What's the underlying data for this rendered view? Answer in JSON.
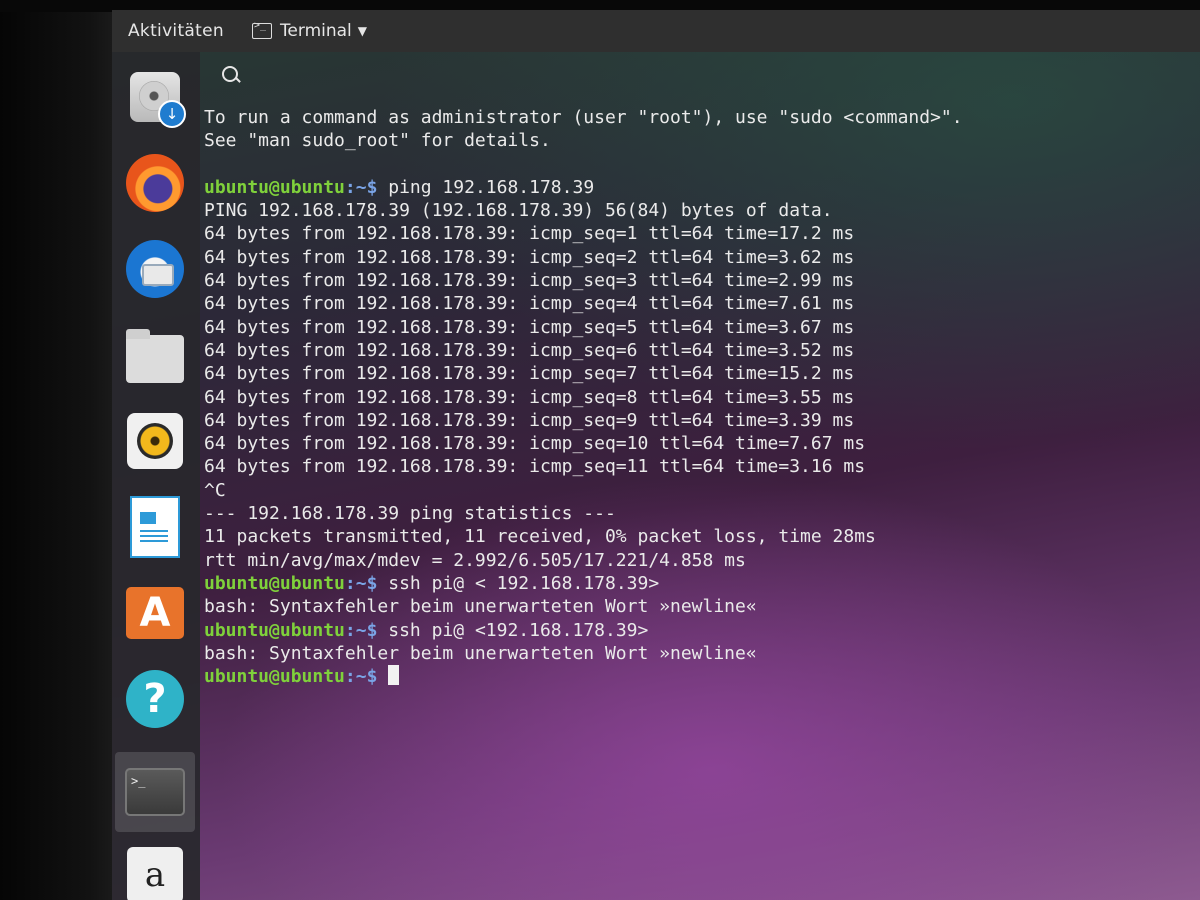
{
  "topbar": {
    "activities": "Aktivitäten",
    "app_name": "Terminal"
  },
  "dock": {
    "items": [
      {
        "icon": "disk-installer-icon"
      },
      {
        "icon": "firefox-icon"
      },
      {
        "icon": "thunderbird-icon"
      },
      {
        "icon": "files-icon"
      },
      {
        "icon": "rhythmbox-icon"
      },
      {
        "icon": "libreoffice-writer-icon"
      },
      {
        "icon": "software-store-icon",
        "glyph": "A"
      },
      {
        "icon": "help-icon",
        "glyph": "?"
      },
      {
        "icon": "terminal-icon",
        "glyph": ">_"
      },
      {
        "icon": "amazon-icon",
        "glyph": "a"
      }
    ]
  },
  "terminal": {
    "prompt_user": "ubuntu@ubuntu",
    "prompt_sep": ":~$ ",
    "lines": [
      {
        "type": "text",
        "text": "To run a command as administrator (user \"root\"), use \"sudo <command>\"."
      },
      {
        "type": "text",
        "text": "See \"man sudo_root\" for details."
      },
      {
        "type": "text",
        "text": ""
      },
      {
        "type": "prompt",
        "cmd": "ping 192.168.178.39"
      },
      {
        "type": "text",
        "text": "PING 192.168.178.39 (192.168.178.39) 56(84) bytes of data."
      },
      {
        "type": "text",
        "text": "64 bytes from 192.168.178.39: icmp_seq=1 ttl=64 time=17.2 ms"
      },
      {
        "type": "text",
        "text": "64 bytes from 192.168.178.39: icmp_seq=2 ttl=64 time=3.62 ms"
      },
      {
        "type": "text",
        "text": "64 bytes from 192.168.178.39: icmp_seq=3 ttl=64 time=2.99 ms"
      },
      {
        "type": "text",
        "text": "64 bytes from 192.168.178.39: icmp_seq=4 ttl=64 time=7.61 ms"
      },
      {
        "type": "text",
        "text": "64 bytes from 192.168.178.39: icmp_seq=5 ttl=64 time=3.67 ms"
      },
      {
        "type": "text",
        "text": "64 bytes from 192.168.178.39: icmp_seq=6 ttl=64 time=3.52 ms"
      },
      {
        "type": "text",
        "text": "64 bytes from 192.168.178.39: icmp_seq=7 ttl=64 time=15.2 ms"
      },
      {
        "type": "text",
        "text": "64 bytes from 192.168.178.39: icmp_seq=8 ttl=64 time=3.55 ms"
      },
      {
        "type": "text",
        "text": "64 bytes from 192.168.178.39: icmp_seq=9 ttl=64 time=3.39 ms"
      },
      {
        "type": "text",
        "text": "64 bytes from 192.168.178.39: icmp_seq=10 ttl=64 time=7.67 ms"
      },
      {
        "type": "text",
        "text": "64 bytes from 192.168.178.39: icmp_seq=11 ttl=64 time=3.16 ms"
      },
      {
        "type": "text",
        "text": "^C"
      },
      {
        "type": "text",
        "text": "--- 192.168.178.39 ping statistics ---"
      },
      {
        "type": "text",
        "text": "11 packets transmitted, 11 received, 0% packet loss, time 28ms"
      },
      {
        "type": "text",
        "text": "rtt min/avg/max/mdev = 2.992/6.505/17.221/4.858 ms"
      },
      {
        "type": "prompt",
        "cmd": "ssh pi@ < 192.168.178.39>"
      },
      {
        "type": "text",
        "text": "bash: Syntaxfehler beim unerwarteten Wort »newline«"
      },
      {
        "type": "prompt",
        "cmd": "ssh pi@ <192.168.178.39>"
      },
      {
        "type": "text",
        "text": "bash: Syntaxfehler beim unerwarteten Wort »newline«"
      },
      {
        "type": "prompt",
        "cmd": "",
        "cursor": true
      }
    ]
  },
  "colors": {
    "prompt_user": "#7fd13b",
    "prompt_path": "#7aa4e6",
    "topbar_bg": "#2f2f2f",
    "dock_bg": "#28282c"
  }
}
